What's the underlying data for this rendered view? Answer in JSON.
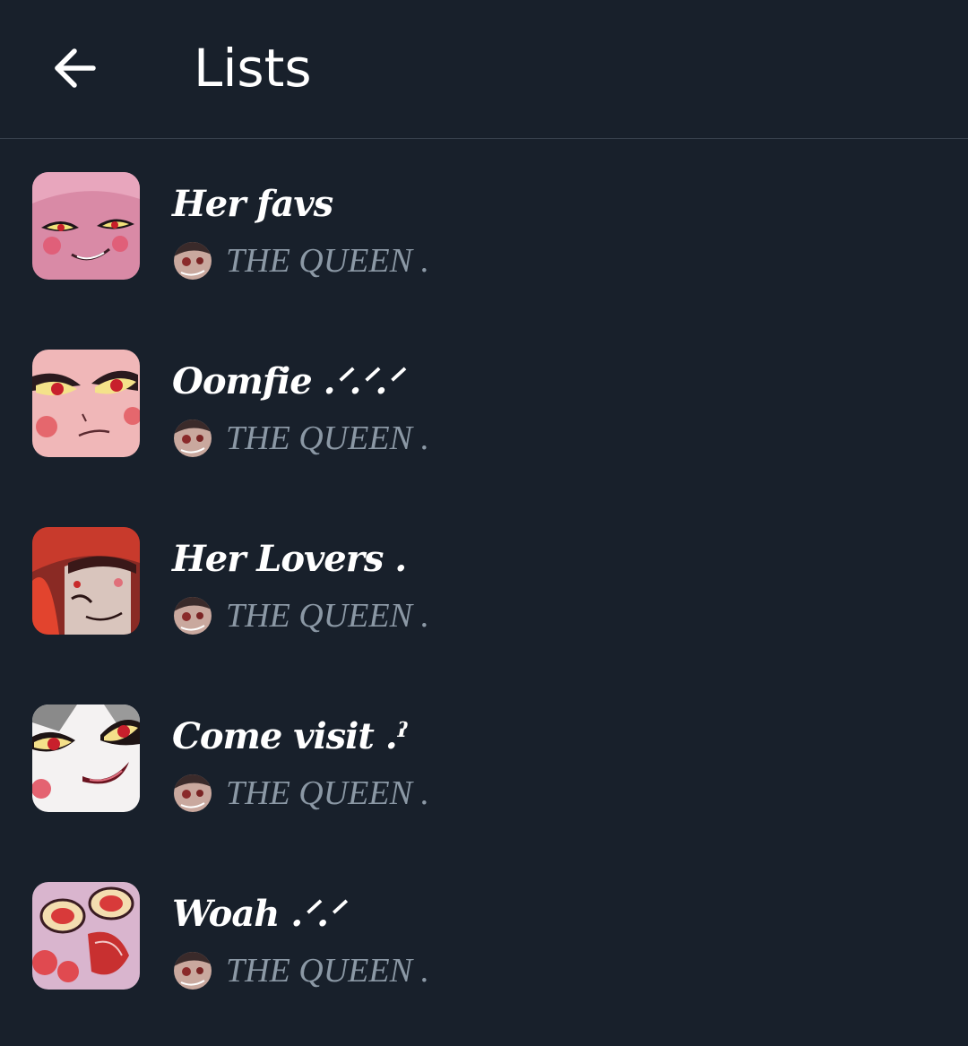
{
  "header": {
    "title": "Lists",
    "back_icon": "arrow-left-icon"
  },
  "lists": [
    {
      "name": "Her favs",
      "owner": "THE QUEEN ."
    },
    {
      "name": "Oomfie .ᐟ.ᐟ.ᐟ",
      "owner": "THE QUEEN ."
    },
    {
      "name": "Her Lovers .",
      "owner": "THE QUEEN ."
    },
    {
      "name": "Come visit .ˀ",
      "owner": "THE QUEEN ."
    },
    {
      "name": "Woah .ᐟ.ᐟ",
      "owner": "THE QUEEN ."
    }
  ],
  "colors": {
    "background": "#18202b",
    "divider": "#38414d",
    "secondary_text": "#8b98a5",
    "primary_text": "#ffffff"
  }
}
